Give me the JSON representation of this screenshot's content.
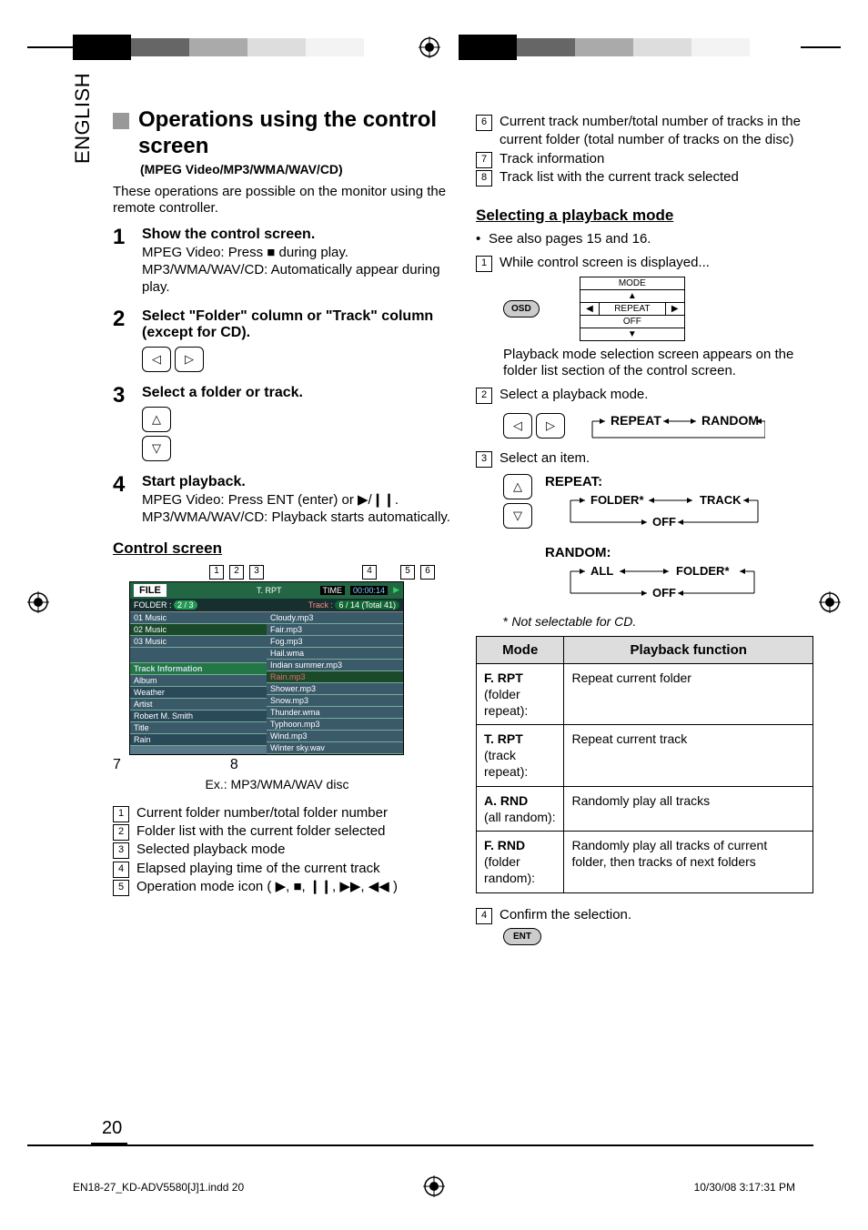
{
  "side_tab": "ENGLISH",
  "header_marker": "⊕",
  "left": {
    "title": "Operations using the control screen",
    "subtitle": "(MPEG Video/MP3/WMA/WAV/CD)",
    "intro": "These operations are possible on the monitor using the remote controller.",
    "steps": [
      {
        "head": "Show the control screen.",
        "body": "MPEG Video: Press ■ during play.\nMP3/WMA/WAV/CD: Automatically appear during play."
      },
      {
        "head": "Select \"Folder\" column or \"Track\" column (except for CD).",
        "body": "",
        "buttons": [
          "◁",
          "▷"
        ]
      },
      {
        "head": "Select a folder or track.",
        "body": "",
        "buttons": [
          "△",
          "▽"
        ],
        "buttons_vertical": true
      },
      {
        "head": "Start playback.",
        "body": "MPEG Video: Press ENT (enter) or ▶/❙❙.\nMP3/WMA/WAV/CD: Playback starts automatically."
      }
    ],
    "control_heading": "Control screen",
    "control_caption": "Ex.: MP3/WMA/WAV disc",
    "control_screen": {
      "file_label": "FILE",
      "trpt": "T. RPT",
      "time_label": "TIME",
      "time_value": "00:00:14",
      "play_icon": "▶",
      "folder_label": "FOLDER :",
      "folder_value": "2 / 3",
      "track_label": "Track :",
      "track_value": "6 / 14 (Total 41)",
      "folders": [
        "01 Music",
        "02 Music",
        "03 Music"
      ],
      "track_info_header": "Track Information",
      "track_info": [
        [
          "Album",
          "Weather"
        ],
        [
          "Artist",
          "Robert M. Smith"
        ],
        [
          "Title",
          "Rain"
        ]
      ],
      "tracks": [
        "Cloudy.mp3",
        "Fair.mp3",
        "Fog.mp3",
        "Hail.wma",
        "Indian summer.mp3",
        "Rain.mp3",
        "Shower.mp3",
        "Snow.mp3",
        "Thunder.wma",
        "Typhoon.mp3",
        "Wind.mp3",
        "Winter sky.wav"
      ],
      "selected_track_index": 5,
      "callouts_top": [
        "1",
        "2",
        "3",
        "4",
        "5",
        "6"
      ],
      "callouts_bottom": [
        "7",
        "8"
      ]
    },
    "legend": [
      "Current folder number/total folder number",
      "Folder list with the current folder selected",
      "Selected playback mode",
      "Elapsed playing time of the current track",
      "Operation mode icon ( ▶, ■, ❙❙, ▶▶, ◀◀ )"
    ]
  },
  "right": {
    "legend_cont": [
      "Current track number/total number of tracks in the current folder (total number of tracks on the disc)",
      "Track information",
      "Track list with the current track selected"
    ],
    "legend_cont_start": 6,
    "sel_heading": "Selecting a playback mode",
    "see_also": "See also pages 15 and 16.",
    "step1": "While control screen is displayed...",
    "osd_label": "OSD",
    "mode_popup": {
      "title": "MODE",
      "row": "REPEAT",
      "off": "OFF"
    },
    "after_osd": "Playback mode selection screen appears on the folder list section of the control screen.",
    "step2": "Select a playback mode.",
    "step2_buttons": [
      "◁",
      "▷"
    ],
    "cycle2": "REPEAT ↔ RANDOM",
    "step3": "Select an item.",
    "step3_buttons": [
      "△",
      "▽"
    ],
    "repeat_label": "REPEAT:",
    "repeat_cycle": "FOLDER* ↔ TRACK ↔ OFF",
    "random_label": "RANDOM:",
    "random_cycle": "ALL ↔ FOLDER* ↔ OFF",
    "footnote": "* Not selectable for CD.",
    "table": {
      "headers": [
        "Mode",
        "Playback function"
      ],
      "rows": [
        {
          "mode": "F. RPT",
          "sub": "(folder repeat):",
          "func": "Repeat current folder"
        },
        {
          "mode": "T. RPT",
          "sub": "(track repeat):",
          "func": "Repeat current track"
        },
        {
          "mode": "A. RND",
          "sub": "(all random):",
          "func": "Randomly play all tracks"
        },
        {
          "mode": "F. RND",
          "sub": "(folder random):",
          "func": "Randomly play all tracks of current folder, then tracks of next folders"
        }
      ]
    },
    "step4": "Confirm the selection.",
    "ent_label": "ENT"
  },
  "footer": {
    "page_number": "20",
    "meta_left": "EN18-27_KD-ADV5580[J]1.indd   20",
    "meta_right": "10/30/08   3:17:31 PM"
  }
}
